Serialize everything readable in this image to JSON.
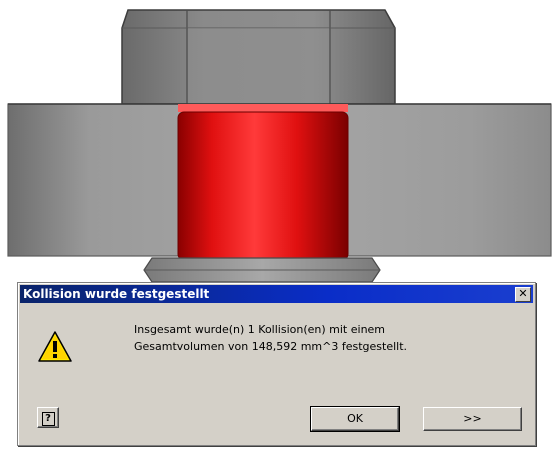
{
  "dialog": {
    "title": "Kollision wurde festgestellt",
    "close_label": "✕",
    "icon": "warning-icon",
    "message_line1": "Insgesamt wurde(n) 1 Kollision(en) mit einem",
    "message_line2": "Gesamtvolumen von 148,592 mm^3 festgestellt.",
    "help_label": "?",
    "ok_label": "OK",
    "more_label": ">>"
  },
  "colors": {
    "title_bar": "#0a246a",
    "collision_highlight": "#e01010",
    "dialog_face": "#d4d0c8",
    "part_gray": "#8a8a8a"
  }
}
